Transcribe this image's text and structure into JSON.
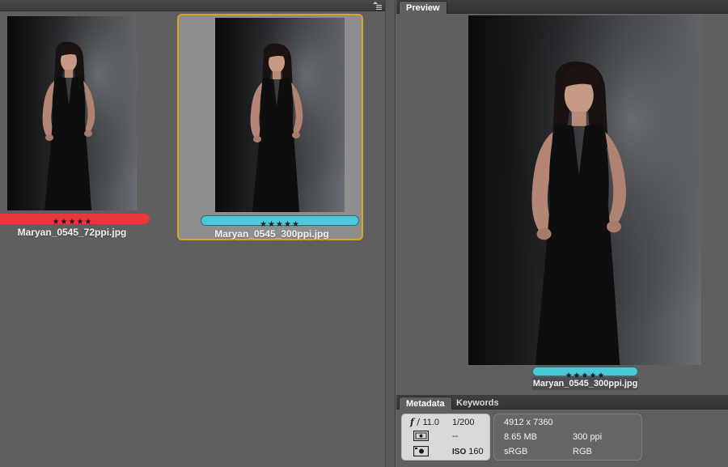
{
  "content_panel": {
    "menu_icon": "panel-menu-icon",
    "thumbnails": [
      {
        "filename": "Maryan_0545_72ppi.jpg",
        "rating": "★★★★★",
        "label_color": "#e8383d",
        "selected": false
      },
      {
        "filename": "Maryan_0545_300ppi.jpg",
        "rating": "★★★★★",
        "label_color": "#4cc8d8",
        "selected": true
      }
    ]
  },
  "preview_panel": {
    "tab": "Preview",
    "rating": "★★★★★",
    "label_color": "#4cc8d8",
    "filename": "Maryan_0545_300ppi.jpg"
  },
  "metadata_panel": {
    "tabs": [
      "Metadata",
      "Keywords"
    ],
    "camera": {
      "aperture": "11.0",
      "shutter": "1/200",
      "metering": "--",
      "iso_label": "ISO",
      "iso": "160"
    },
    "file": {
      "dimensions": "4912 x 7360",
      "size": "8.65 MB",
      "resolution": "300 ppi",
      "color_profile": "sRGB",
      "color_mode": "RGB"
    }
  },
  "colors": {
    "selection_border": "#d7a41f",
    "panel_bg": "#5f5f5f"
  }
}
